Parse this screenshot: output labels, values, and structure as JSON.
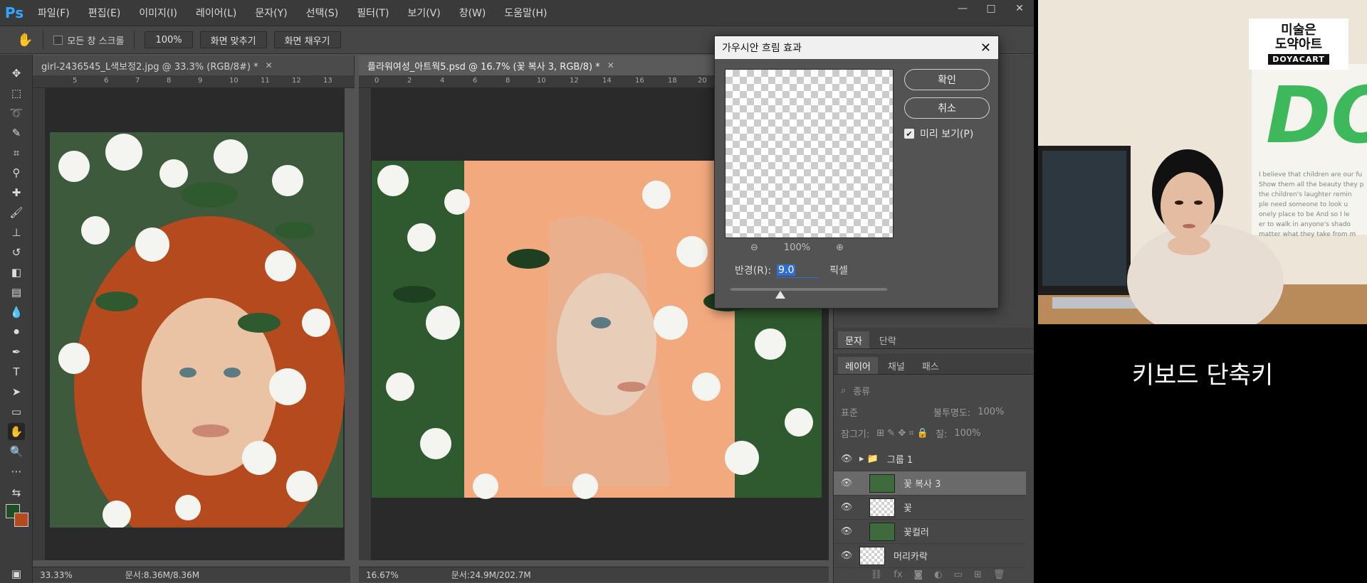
{
  "app": {
    "logo": "Ps",
    "menu": [
      "파일(F)",
      "편집(E)",
      "이미지(I)",
      "레이어(L)",
      "문자(Y)",
      "선택(S)",
      "필터(T)",
      "보기(V)",
      "창(W)",
      "도움말(H)"
    ],
    "window_controls": {
      "minimize": "—",
      "restore": "□",
      "close": "✕"
    }
  },
  "options_bar": {
    "tool_icon": "hand-icon",
    "scroll_all_windows": "모든 창 스크롤",
    "zoom": "100%",
    "fit_screen": "화면 맞추기",
    "fill_screen": "화면 채우기"
  },
  "documents": [
    {
      "tab": "girl-2436545_L색보정2.jpg @ 33.3% (RGB/8#) *",
      "close": "✕",
      "zoom_status": "33.33%",
      "doc_status": "문서:8.36M/8.36M"
    },
    {
      "tab": "플라워여성_아트웍5.psd @ 16.7% (꽃 복사 3, RGB/8) *",
      "close": "✕",
      "zoom_status": "16.67%",
      "doc_status": "문서:24.9M/202.7M"
    }
  ],
  "rulers": {
    "doc1_h": [
      "5",
      "6",
      "7",
      "8",
      "9",
      "10",
      "11",
      "12",
      "13"
    ],
    "doc2_h": [
      "0",
      "2",
      "4",
      "6",
      "8",
      "10",
      "12",
      "14",
      "16",
      "18",
      "20"
    ]
  },
  "dialog": {
    "title": "가우시안 흐림 효과",
    "close": "✕",
    "ok": "확인",
    "cancel": "취소",
    "preview_label": "미리 보기(P)",
    "zoom_percent": "100%",
    "radius_label": "반경(R):",
    "radius_value": "9.0",
    "unit": "픽셀",
    "slider_fraction": 0.32
  },
  "panels": {
    "char_tabs": [
      "문자",
      "단락"
    ],
    "layer_tabs": [
      "레이어",
      "채널",
      "패스"
    ],
    "filter_kind": "종류",
    "blend_mode": "표준",
    "opacity_label": "불투명도:",
    "opacity_value": "100%",
    "lock_label": "잠그기:",
    "fill_label": "칠:",
    "fill_value": "100%",
    "layers": [
      {
        "name": "그룹 1",
        "type": "group",
        "active": false
      },
      {
        "name": "꽃 복사 3",
        "type": "image",
        "active": true
      },
      {
        "name": "꽃",
        "type": "empty",
        "active": false
      },
      {
        "name": "꽃컬러",
        "type": "image",
        "active": false
      },
      {
        "name": "머리카락",
        "type": "empty",
        "active": false
      }
    ]
  },
  "video": {
    "brand_ko_1": "미술은",
    "brand_ko_2": "도약아트",
    "brand_en": "DOYACART",
    "wall_text": "DO",
    "wall_lines": [
      "I believe that children are our fu",
      "Show them all the beauty they p",
      "the children's laughter remin",
      "ple need someone to look u",
      "onely place to be And so I le",
      "er to walk in anyone's shado",
      "matter what they take from m"
    ],
    "shortcut_caption": "키보드 단축키"
  },
  "colors": {
    "accent_blue": "#2f6fd1",
    "ps_blue": "#31a8ff",
    "peach": "#f3a97e",
    "leaf": "#2f5a2f",
    "hair": "#b44a1e",
    "brand_green": "#3db85a"
  }
}
